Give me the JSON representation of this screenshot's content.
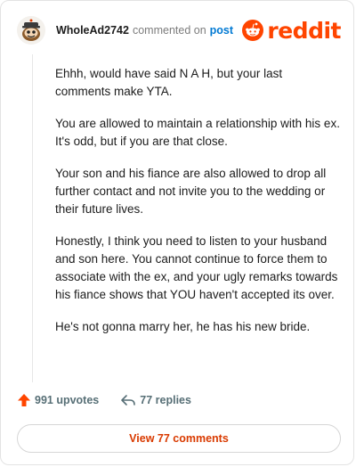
{
  "header": {
    "username": "WholeAd2742",
    "commented_on": "commented on",
    "post_link": "post",
    "logo_word": "reddit"
  },
  "comment": {
    "paragraphs": [
      "Ehhh, would have said N A H, but your last comments make YTA.",
      "You are allowed to maintain a relationship with his ex. It's odd, but if you are that close.",
      "Your son and his fiance are also allowed to drop all further contact and not invite you to the wedding or their future lives.",
      "Honestly, I think you need to listen to your husband and son here. You cannot continue to force them to associate with the ex, and your ugly remarks towards his fiance shows that YOU haven't accepted its over.",
      "He's not gonna marry her, he has his new bride."
    ]
  },
  "actions": {
    "upvotes": "991 upvotes",
    "replies": "77 replies"
  },
  "footer": {
    "view_button": "View 77 comments"
  },
  "colors": {
    "brand": "#ff4500",
    "link": "#0079d3",
    "view_button_text": "#d93a00"
  },
  "icons": {
    "avatar": "snoo-avatar-icon",
    "logo": "reddit-alien-icon",
    "upvote": "upvote-arrow-icon",
    "reply": "reply-arrow-icon"
  }
}
